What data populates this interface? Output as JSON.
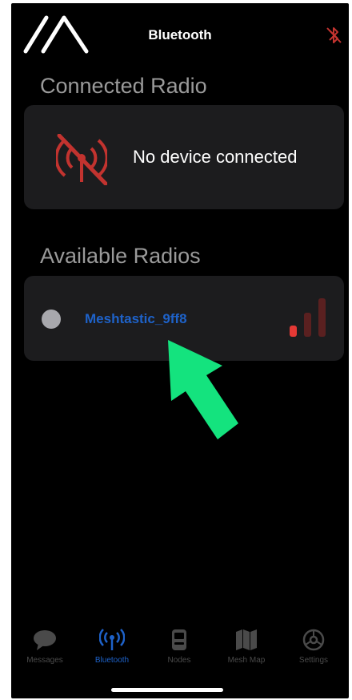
{
  "header": {
    "title": "Bluetooth",
    "logo_icon": "meshtastic-logo-icon",
    "status_icon": "bluetooth-disconnected-icon"
  },
  "connected_section": {
    "title": "Connected Radio",
    "status_text": "No device connected",
    "icon": "antenna-slash-icon"
  },
  "available_section": {
    "title": "Available Radios",
    "devices": [
      {
        "name": "Meshtastic_9ff8",
        "signal_level": 1,
        "signal_max": 3
      }
    ]
  },
  "tabs": [
    {
      "label": "Messages",
      "icon": "message-bubble-icon",
      "active": false
    },
    {
      "label": "Bluetooth",
      "icon": "antenna-icon",
      "active": true
    },
    {
      "label": "Nodes",
      "icon": "device-icon",
      "active": false
    },
    {
      "label": "Mesh Map",
      "icon": "map-icon",
      "active": false
    },
    {
      "label": "Settings",
      "icon": "gear-icon",
      "active": false
    }
  ],
  "colors": {
    "background": "#000000",
    "card": "#1c1c1e",
    "accent": "#1e62c9",
    "alert": "#c2332f",
    "arrow": "#14e37e"
  }
}
